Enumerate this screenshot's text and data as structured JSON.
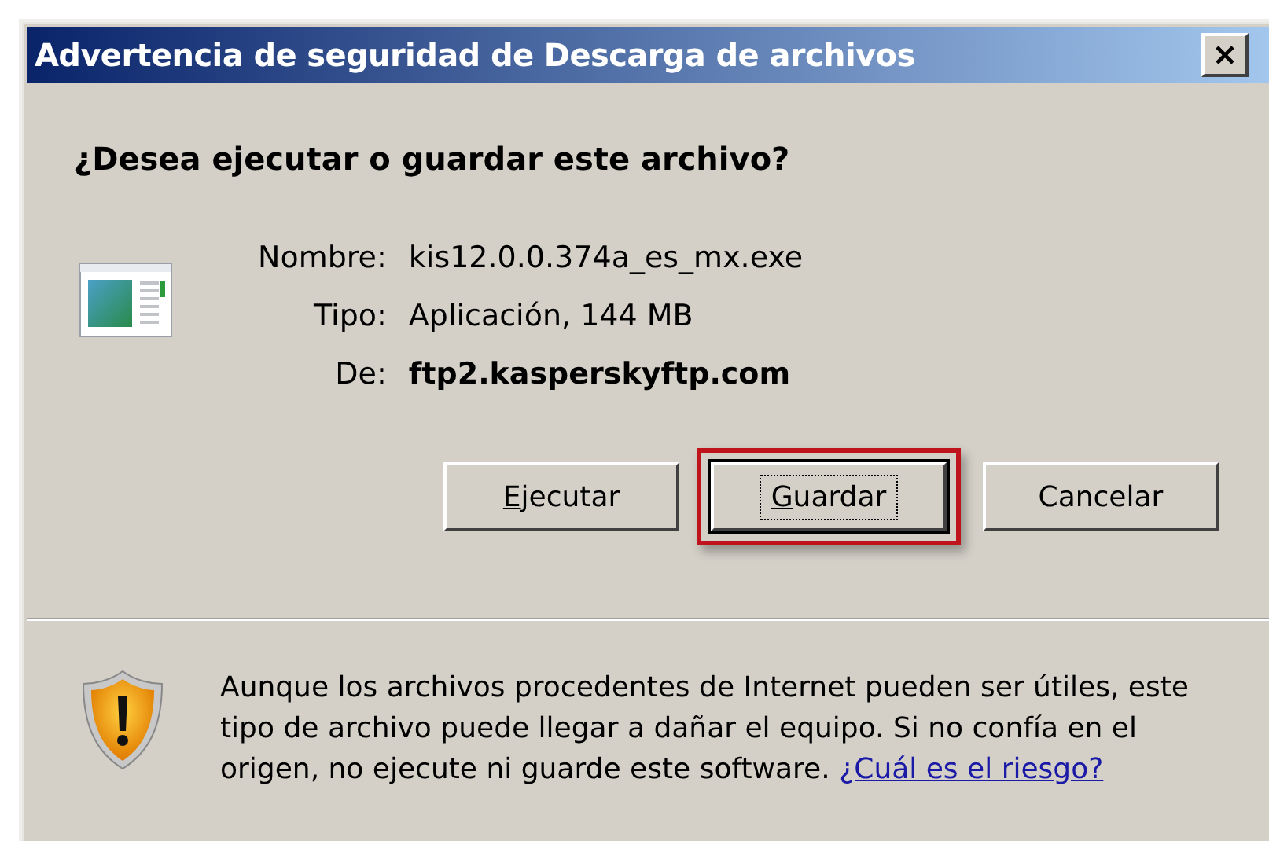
{
  "window": {
    "title": "Advertencia de seguridad de Descarga de archivos"
  },
  "question": "¿Desea ejecutar o guardar este archivo?",
  "details": [
    {
      "label": "Nombre:",
      "value": "kis12.0.0.374a_es_mx.exe",
      "bold": false
    },
    {
      "label": "Tipo:",
      "value": "Aplicación, 144 MB",
      "bold": false
    },
    {
      "label": "De:",
      "value": "ftp2.kasperskyftp.com",
      "bold": true
    }
  ],
  "buttons": [
    {
      "label": "Ejecutar",
      "mnemonic": true,
      "default": false,
      "highlighted": false
    },
    {
      "label": "Guardar",
      "mnemonic": true,
      "default": true,
      "highlighted": true
    },
    {
      "label": "Cancelar",
      "mnemonic": false,
      "default": false,
      "highlighted": false
    }
  ],
  "warning": {
    "text": "Aunque los archivos procedentes de Internet pueden ser útiles, este tipo de archivo puede llegar a dañar el equipo. Si no confía en el origen, no ejecute ni guarde este software.",
    "link": "¿Cuál es el riesgo?"
  }
}
